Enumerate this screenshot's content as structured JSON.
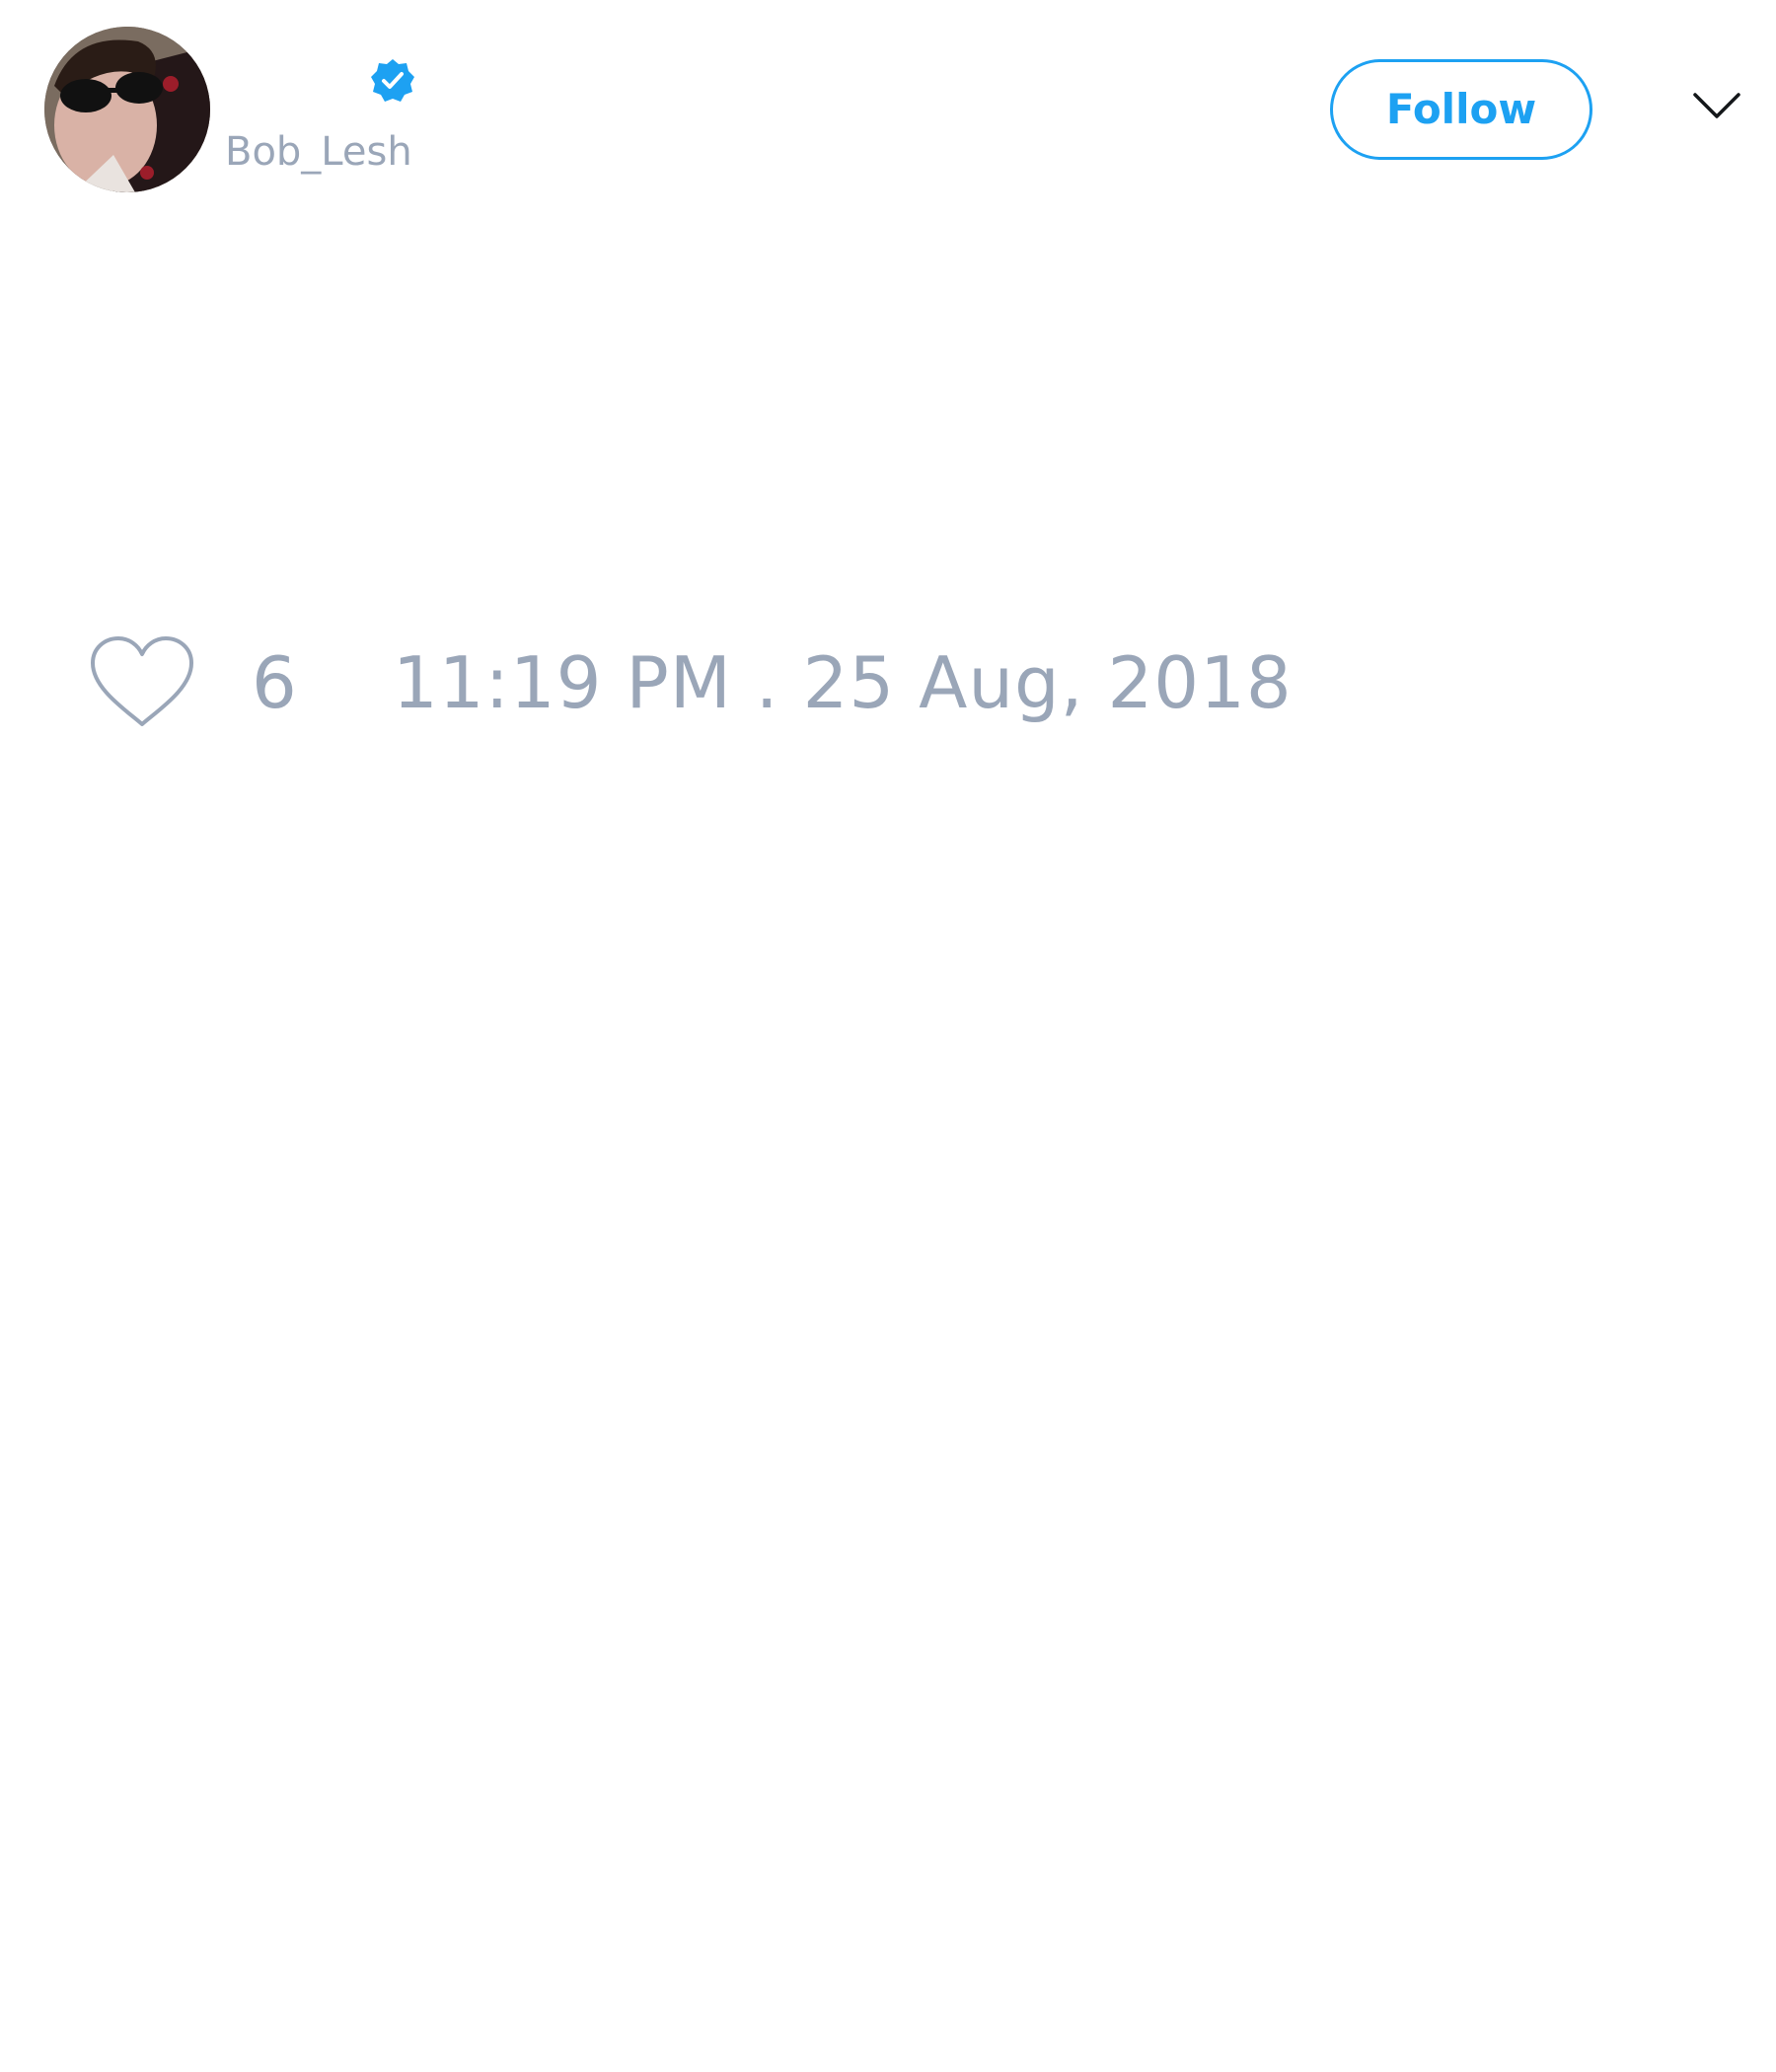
{
  "tweet": {
    "author": {
      "handle": "Bob_Lesh",
      "verified": true
    },
    "follow_label": "Follow",
    "likes": "6",
    "timestamp": "11:19 PM . 25 Aug, 2018"
  },
  "icons": {
    "verified": "verified-badge-icon",
    "more": "chevron-down-icon",
    "like": "heart-icon"
  },
  "colors": {
    "accent": "#1da1f2",
    "muted_text": "#9aa6b8",
    "background": "#ffffff"
  }
}
